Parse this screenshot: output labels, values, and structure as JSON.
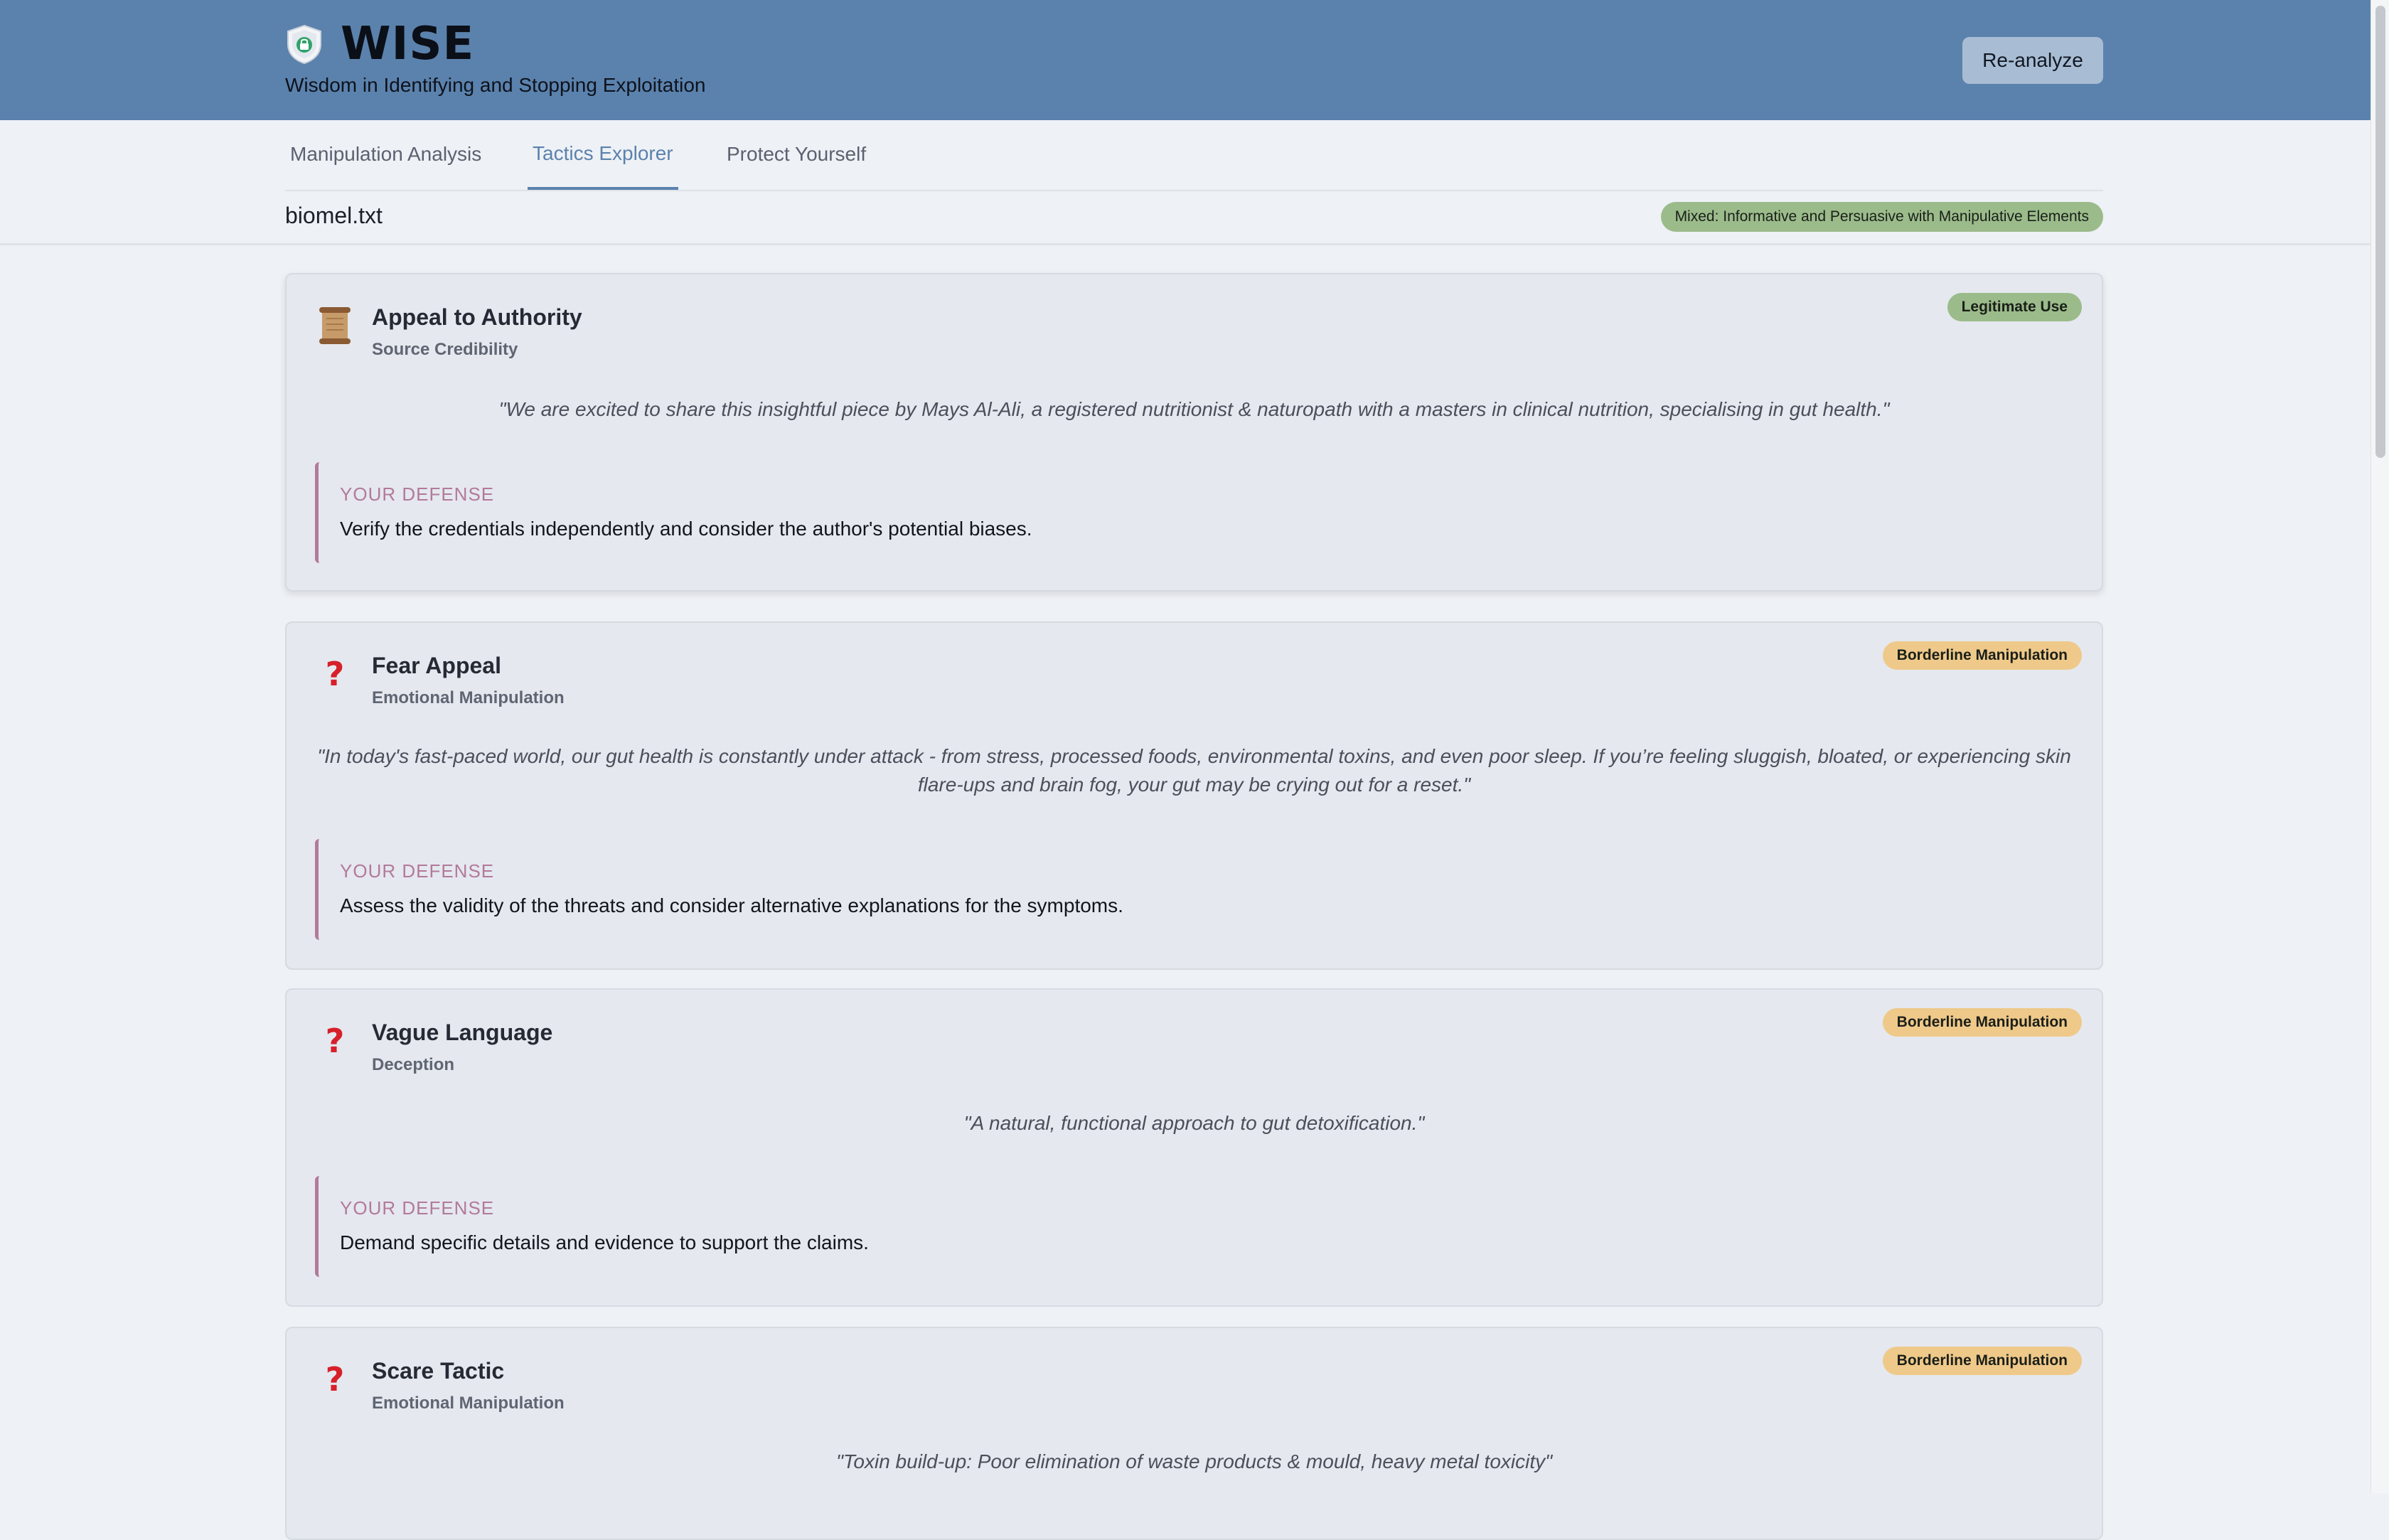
{
  "header": {
    "title": "WISE",
    "tagline": "Wisdom in Identifying and Stopping Exploitation",
    "reanalyze_label": "Re-analyze",
    "logo_icon": "shield-lock-icon"
  },
  "tabs": [
    {
      "label": "Manipulation Analysis",
      "active": false
    },
    {
      "label": "Tactics Explorer",
      "active": true
    },
    {
      "label": "Protect Yourself",
      "active": false
    }
  ],
  "file": {
    "name": "biomel.txt",
    "classification": "Mixed: Informative and Persuasive with Manipulative Elements"
  },
  "colors": {
    "header_bg": "#5b82ad",
    "legitimate": "#9bbb8b",
    "borderline": "#efc98a",
    "defense_accent": "#b27a9a"
  },
  "defense_label": "YOUR DEFENSE",
  "tactics": [
    {
      "name": "Appeal to Authority",
      "category": "Source Credibility",
      "badge": "Legitimate Use",
      "icon": "scroll-icon",
      "quote": "\"We are excited to share this insightful piece by Mays Al-Ali, a registered nutritionist & naturopath with a masters in clinical nutrition, specialising in gut health.\"",
      "defense": "Verify the credentials independently and consider the author's potential biases."
    },
    {
      "name": "Fear Appeal",
      "category": "Emotional Manipulation",
      "badge": "Borderline Manipulation",
      "icon": "question-mark-icon",
      "quote": "\"In today's fast-paced world, our gut health is constantly under attack - from stress, processed foods, environmental toxins, and even poor sleep. If you’re feeling sluggish, bloated, or experiencing skin flare-ups and brain fog, your gut may be crying out for a reset.\"",
      "defense": "Assess the validity of the threats and consider alternative explanations for the symptoms."
    },
    {
      "name": "Vague Language",
      "category": "Deception",
      "badge": "Borderline Manipulation",
      "icon": "question-mark-icon",
      "quote": "\"A natural, functional approach to gut detoxification.\"",
      "defense": "Demand specific details and evidence to support the claims."
    },
    {
      "name": "Scare Tactic",
      "category": "Emotional Manipulation",
      "badge": "Borderline Manipulation",
      "icon": "question-mark-icon",
      "quote": "\"Toxin build-up: Poor elimination of waste products & mould, heavy metal toxicity\""
    }
  ]
}
